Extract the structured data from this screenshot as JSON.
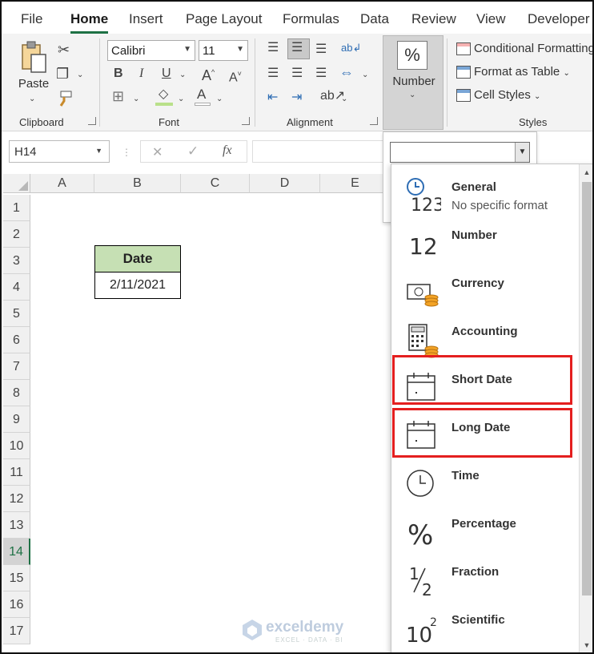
{
  "tabs": [
    "File",
    "Home",
    "Insert",
    "Page Layout",
    "Formulas",
    "Data",
    "Review",
    "View",
    "Developer"
  ],
  "active_tab": "Home",
  "ribbon": {
    "clipboard": {
      "paste_label": "Paste",
      "group_label": "Clipboard"
    },
    "font": {
      "name": "Calibri",
      "size": "11",
      "group_label": "Font"
    },
    "alignment": {
      "group_label": "Alignment"
    },
    "number": {
      "label": "Number",
      "icon_text": "%"
    },
    "styles": {
      "items": [
        "Conditional Formatting",
        "Format as Table",
        "Cell Styles"
      ],
      "group_label": "Styles"
    }
  },
  "formula_bar": {
    "name_box": "H14",
    "fx": "fx",
    "cancel": "✕",
    "enter": "✓"
  },
  "grid": {
    "columns": [
      "A",
      "B",
      "C",
      "D",
      "E"
    ],
    "rows": [
      "1",
      "2",
      "3",
      "4",
      "5",
      "6",
      "7",
      "8",
      "9",
      "10",
      "11",
      "12",
      "13",
      "14",
      "15",
      "16",
      "17"
    ],
    "selected_row": "14",
    "table_header": "Date",
    "table_value": "2/11/2021"
  },
  "format_list": {
    "items": [
      {
        "name": "General",
        "desc": "No specific format",
        "icon": "general-icon"
      },
      {
        "name": "Number",
        "desc": "",
        "icon": "number-icon"
      },
      {
        "name": "Currency",
        "desc": "",
        "icon": "currency-icon"
      },
      {
        "name": "Accounting",
        "desc": "",
        "icon": "accounting-icon"
      },
      {
        "name": "Short Date",
        "desc": "",
        "icon": "calendar-icon"
      },
      {
        "name": "Long Date",
        "desc": "",
        "icon": "calendar-icon"
      },
      {
        "name": "Time",
        "desc": "",
        "icon": "clock-icon"
      },
      {
        "name": "Percentage",
        "desc": "",
        "icon": "percent-icon"
      },
      {
        "name": "Fraction",
        "desc": "",
        "icon": "fraction-icon"
      },
      {
        "name": "Scientific",
        "desc": "",
        "icon": "scientific-icon"
      }
    ],
    "highlighted": [
      "Short Date",
      "Long Date"
    ],
    "highlight_color": "#e41f1f"
  },
  "watermark": {
    "name": "exceldemy",
    "tagline": "EXCEL · DATA · BI"
  }
}
